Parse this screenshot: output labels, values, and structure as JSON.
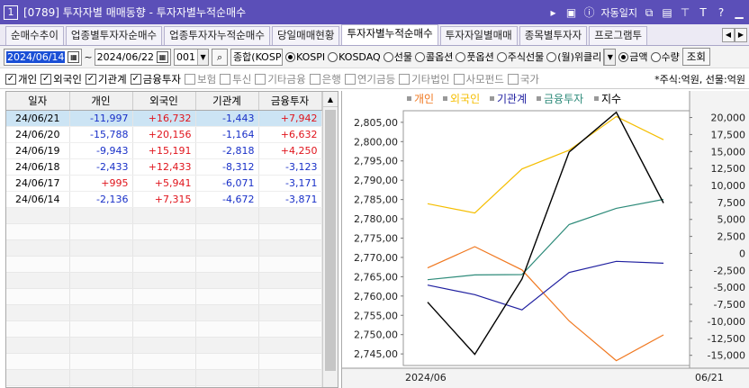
{
  "window": {
    "number": "1",
    "title": "[0789] 투자자별 매매동향 - 투자자별누적순매수",
    "auto_label": "자동일지"
  },
  "tabs": [
    {
      "label": "순매수추이",
      "active": false
    },
    {
      "label": "업종별투자자순매수",
      "active": false
    },
    {
      "label": "업종투자자누적순매수",
      "active": false
    },
    {
      "label": "당일매매현황",
      "active": false
    },
    {
      "label": "투자자별누적순매수",
      "active": true
    },
    {
      "label": "투자자일별매매",
      "active": false
    },
    {
      "label": "종목별투자자",
      "active": false
    },
    {
      "label": "프로그램투",
      "active": false
    }
  ],
  "toolbar": {
    "start_date": "2024/06/14",
    "end_date": "2024/06/22",
    "code": "001",
    "market_name": "종합(KOSP",
    "radios": [
      {
        "label": "KOSPI",
        "checked": true
      },
      {
        "label": "KOSDAQ",
        "checked": false
      },
      {
        "label": "선물",
        "checked": false
      },
      {
        "label": "콜옵션",
        "checked": false
      },
      {
        "label": "풋옵션",
        "checked": false
      },
      {
        "label": "주식선물",
        "checked": false
      },
      {
        "label": "(월)위클리",
        "checked": false
      }
    ],
    "value_radios": [
      {
        "label": "금액",
        "checked": true
      },
      {
        "label": "수량",
        "checked": false
      }
    ],
    "query_label": "조회"
  },
  "filters": {
    "items": [
      {
        "label": "개인",
        "checked": true
      },
      {
        "label": "외국인",
        "checked": true
      },
      {
        "label": "기관계",
        "checked": true
      },
      {
        "label": "금융투자",
        "checked": true
      },
      {
        "label": "보험",
        "checked": false
      },
      {
        "label": "투신",
        "checked": false
      },
      {
        "label": "기타금융",
        "checked": false
      },
      {
        "label": "은행",
        "checked": false
      },
      {
        "label": "연기금등",
        "checked": false
      },
      {
        "label": "기타법인",
        "checked": false
      },
      {
        "label": "사모펀드",
        "checked": false
      },
      {
        "label": "국가",
        "checked": false
      }
    ],
    "unit_note": "*주식:억원, 선물:억원"
  },
  "table": {
    "headers": [
      "일자",
      "개인",
      "외국인",
      "기관계",
      "금융투자"
    ],
    "rows": [
      [
        "24/06/21",
        "-11,997",
        "+16,732",
        "-1,443",
        "+7,942"
      ],
      [
        "24/06/20",
        "-15,788",
        "+20,156",
        "-1,164",
        "+6,632"
      ],
      [
        "24/06/19",
        "-9,943",
        "+15,191",
        "-2,818",
        "+4,250"
      ],
      [
        "24/06/18",
        "-2,433",
        "+12,433",
        "-8,312",
        "-3,123"
      ],
      [
        "24/06/17",
        "+995",
        "+5,941",
        "-6,071",
        "-3,171"
      ],
      [
        "24/06/14",
        "-2,136",
        "+7,315",
        "-4,672",
        "-3,871"
      ]
    ]
  },
  "chart_data": {
    "type": "line",
    "x": [
      "24/06/14",
      "24/06/17",
      "24/06/18",
      "24/06/19",
      "24/06/20",
      "24/06/21"
    ],
    "series": [
      {
        "name": "개인",
        "color": "#f07820",
        "axis": "right",
        "values": [
          -2136,
          995,
          -2433,
          -9943,
          -15788,
          -11997
        ]
      },
      {
        "name": "외국인",
        "color": "#f5be00",
        "axis": "right",
        "values": [
          7315,
          5941,
          12433,
          15191,
          20156,
          16732
        ]
      },
      {
        "name": "기관계",
        "color": "#2020a0",
        "axis": "right",
        "values": [
          -4672,
          -6071,
          -8312,
          -2818,
          -1164,
          -1443
        ]
      },
      {
        "name": "금융투자",
        "color": "#2e8b7a",
        "axis": "right",
        "values": [
          -3871,
          -3171,
          -3123,
          4250,
          6632,
          7942
        ]
      },
      {
        "name": "지수",
        "color": "#000000",
        "axis": "left",
        "values": [
          2758.4,
          2744.9,
          2764.4,
          2797.3,
          2807.6,
          2784.1
        ]
      }
    ],
    "left_axis": {
      "min": 2742,
      "max": 2808,
      "ticks": [
        "2,805,00",
        "2,800,00",
        "2,795,00",
        "2,790,00",
        "2,785,00",
        "2,780,00",
        "2,775,00",
        "2,770,00",
        "2,765,00",
        "2,760,00",
        "2,755,00",
        "2,750,00",
        "2,745,00"
      ]
    },
    "right_axis": {
      "min": -16500,
      "max": 21000,
      "ticks": [
        "20,000",
        "17,500",
        "15,000",
        "12,500",
        "10,000",
        "7,500",
        "5,000",
        "2,500",
        "0",
        "-2,500",
        "-5,000",
        "-7,500",
        "-10,000",
        "-12,500",
        "-15,000"
      ]
    },
    "x_start_label": "2024/06",
    "x_end_label": "06/21"
  }
}
